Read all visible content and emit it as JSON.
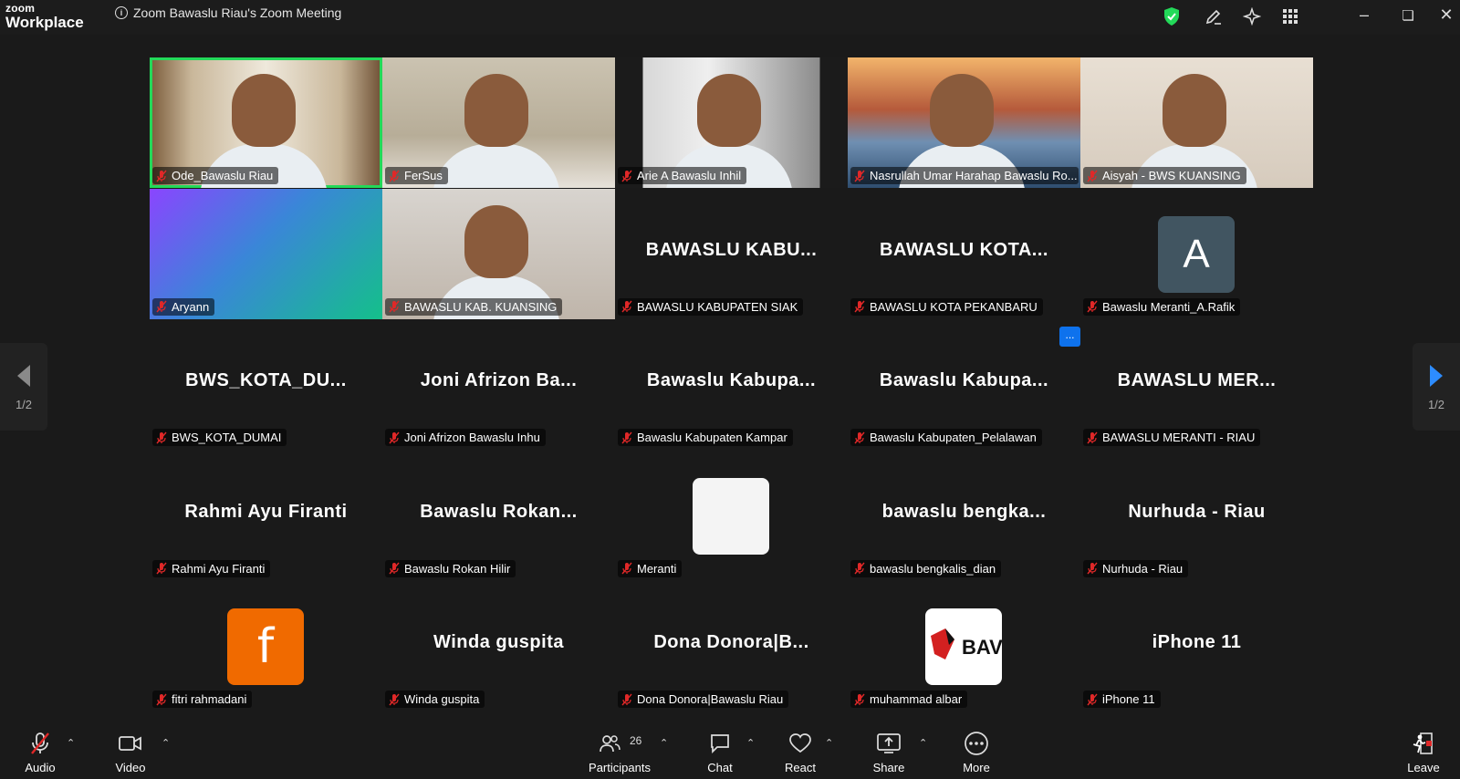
{
  "app": {
    "brand_top": "zoom",
    "brand_bottom": "Workplace",
    "window_title": "Zoom Bawaslu Riau's Zoom Meeting"
  },
  "tiles": [
    {
      "name": "Ode_Bawaslu Riau",
      "kind": "video",
      "active": true
    },
    {
      "name": "FerSus",
      "kind": "video"
    },
    {
      "name": "Arie A Bawaslu Inhil",
      "kind": "video"
    },
    {
      "name": "Nasrullah Umar Harahap Bawaslu Ro...",
      "kind": "video"
    },
    {
      "name": "Aisyah - BWS KUANSING",
      "kind": "video"
    },
    {
      "name": "Aryann",
      "kind": "video"
    },
    {
      "name": "BAWASLU KAB. KUANSING",
      "kind": "video"
    },
    {
      "name": "BAWASLU KABUPATEN SIAK",
      "kind": "text",
      "big": "BAWASLU  KABU..."
    },
    {
      "name": "BAWASLU KOTA PEKANBARU",
      "kind": "text",
      "big": "BAWASLU  KOTA..."
    },
    {
      "name": "Bawaslu Meranti_A.Rafik",
      "kind": "avatar-a",
      "letter": "A"
    },
    {
      "name": "BWS_KOTA_DUMAI",
      "kind": "text",
      "big": "BWS_KOTA_DU..."
    },
    {
      "name": "Joni Afrizon Bawaslu Inhu",
      "kind": "text",
      "big": "Joni  Afrizon  Ba..."
    },
    {
      "name": "Bawaslu Kabupaten Kampar",
      "kind": "text",
      "big": "Bawaslu  Kabupa..."
    },
    {
      "name": "Bawaslu Kabupaten_Pelalawan",
      "kind": "text",
      "big": "Bawaslu  Kabupa..."
    },
    {
      "name": "BAWASLU MERANTI - RIAU",
      "kind": "text",
      "big": "BAWASLU  MER..."
    },
    {
      "name": "Rahmi Ayu Firanti",
      "kind": "text",
      "big": "Rahmi Ayu Firanti"
    },
    {
      "name": "Bawaslu Rokan Hilir",
      "kind": "text",
      "big": "Bawaslu  Rokan..."
    },
    {
      "name": "Meranti",
      "kind": "avatar-blank"
    },
    {
      "name": "bawaslu bengkalis_dian",
      "kind": "text",
      "big": "bawaslu  bengka..."
    },
    {
      "name": "Nurhuda - Riau",
      "kind": "text",
      "big": "Nurhuda - Riau"
    },
    {
      "name": "fitri rahmadani",
      "kind": "avatar-f",
      "letter": "f"
    },
    {
      "name": "Winda guspita",
      "kind": "text",
      "big": "Winda guspita"
    },
    {
      "name": "Dona Donora|Bawaslu Riau",
      "kind": "text",
      "big": "Dona  Donora|B..."
    },
    {
      "name": "muhammad albar",
      "kind": "avatar-bav",
      "letter": "BAV"
    },
    {
      "name": "iPhone 11",
      "kind": "text",
      "big": "iPhone 11"
    }
  ],
  "pager": {
    "left_label": "1/2",
    "right_label": "1/2"
  },
  "more_dots": "...",
  "toolbar": {
    "audio": "Audio",
    "video": "Video",
    "participants": "Participants",
    "participants_count": "26",
    "chat": "Chat",
    "react": "React",
    "share": "Share",
    "more": "More",
    "leave": "Leave"
  },
  "colors": {
    "active_speaker": "#23d959",
    "share_green": "#23d959",
    "accent_blue": "#0e72ed",
    "leave_red": "#e02828"
  },
  "icons": [
    "info-icon",
    "shield-icon",
    "pen-icon",
    "sparkle-icon",
    "apps-grid-icon",
    "minimize-icon",
    "restore-icon",
    "close-icon",
    "mic-off-icon",
    "video-icon",
    "participants-icon",
    "chat-icon",
    "heart-icon",
    "share-screen-icon",
    "more-icon",
    "leave-icon"
  ]
}
